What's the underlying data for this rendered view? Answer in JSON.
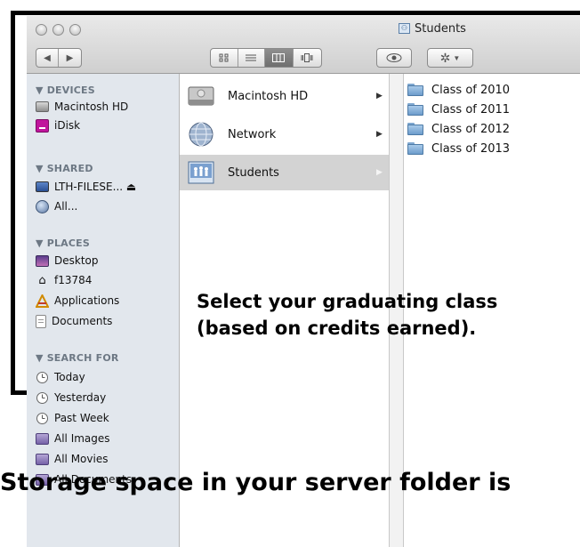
{
  "window": {
    "title": "Students",
    "traffic_lights": [
      "close",
      "minimize",
      "zoom"
    ]
  },
  "toolbar": {
    "back_icon": "◀",
    "forward_icon": "▶",
    "view_icons": [
      "icon-view-icon",
      "list-view-icon",
      "column-view-icon",
      "coverflow-view-icon"
    ],
    "selected_view": "column",
    "quicklook_icon": "eye-icon",
    "action_icon": "gear-icon"
  },
  "sidebar": {
    "sections": [
      {
        "heading": "▼ DEVICES",
        "items": [
          "Macintosh HD",
          "iDisk"
        ]
      },
      {
        "heading": "▼ SHARED",
        "items": [
          "LTH-FILESE... ⏏",
          "All..."
        ]
      },
      {
        "heading": "▼ PLACES",
        "items": [
          "Desktop",
          "f13784",
          "Applications",
          "Documents"
        ]
      },
      {
        "heading": "▼ SEARCH FOR",
        "items": [
          "Today",
          "Yesterday",
          "Past Week",
          "All Images",
          "All Movies",
          "All Documents"
        ]
      }
    ]
  },
  "column1": {
    "items": [
      {
        "label": "Macintosh HD",
        "arrow": "▶",
        "selected": false,
        "icon": "hard-drive-icon"
      },
      {
        "label": "Network",
        "arrow": "▶",
        "selected": false,
        "icon": "network-globe-icon"
      },
      {
        "label": "Students",
        "arrow": "▶",
        "selected": true,
        "icon": "shared-folder-icon"
      }
    ]
  },
  "column3": {
    "items": [
      "Class of 2010",
      "Class of 2011",
      "Class of 2012",
      "Class of 2013"
    ]
  },
  "annotations": {
    "note1_line1": "Select your graduating class",
    "note1_line2": "(based on credits earned).",
    "note2": "Storage space in your server folder is"
  }
}
